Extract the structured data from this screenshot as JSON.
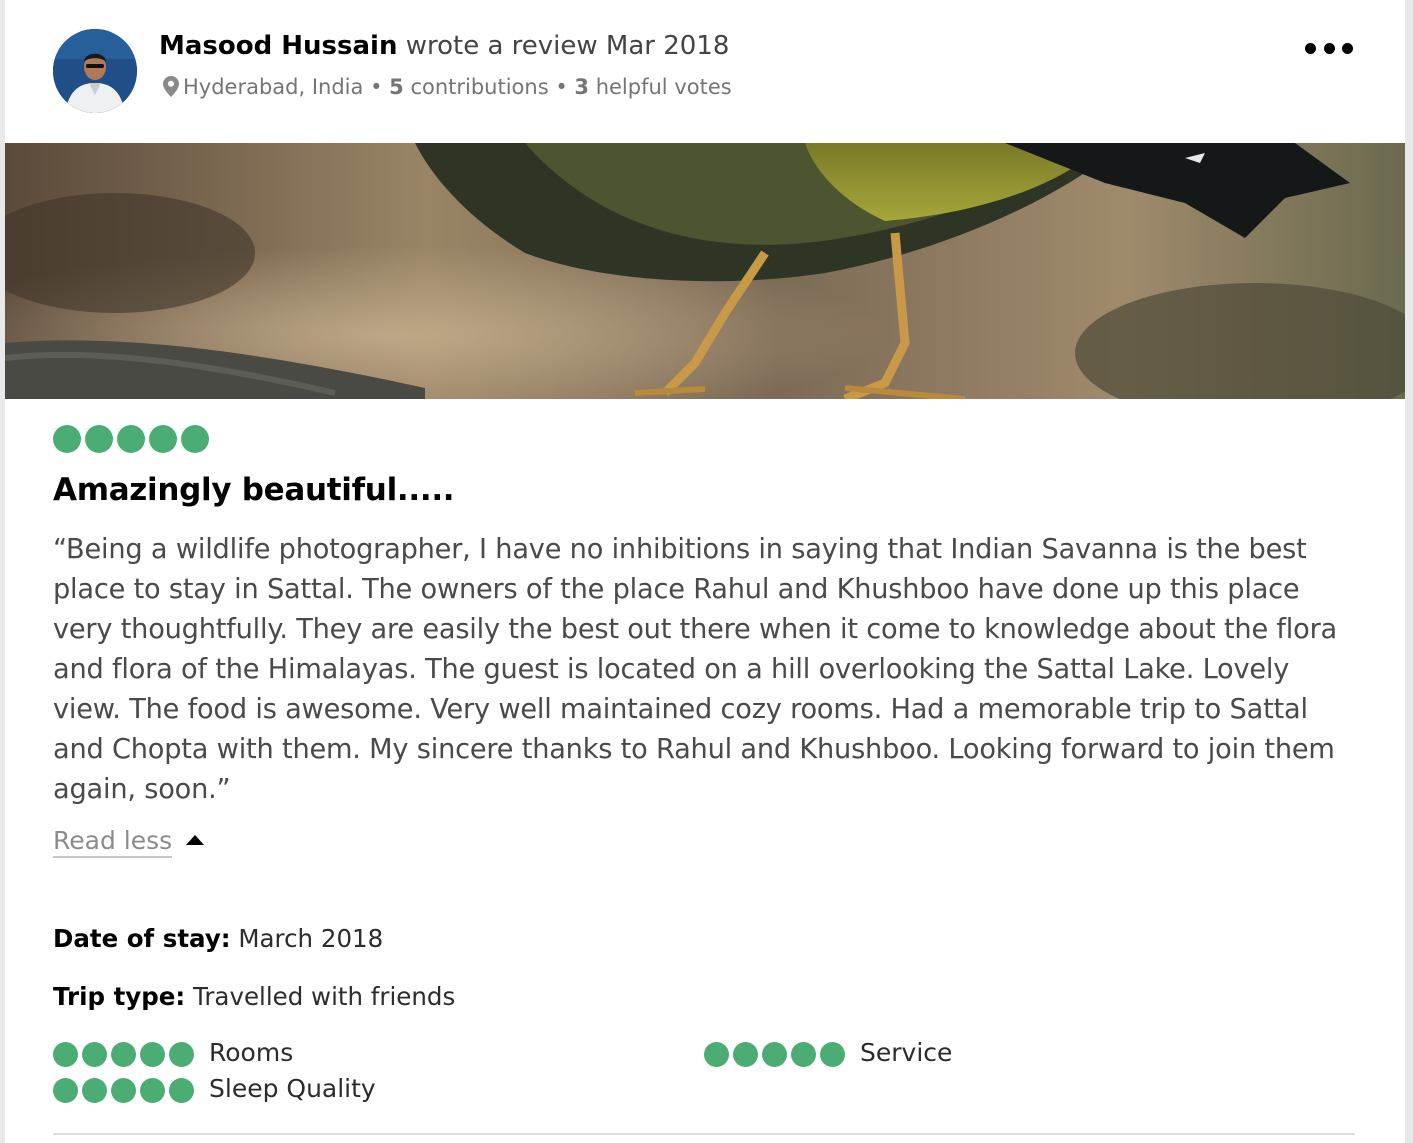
{
  "review": {
    "author_name": "Masood Hussain",
    "wrote_text": " wrote a review Mar 2018",
    "location": "Hyderabad, India",
    "sep1": " • ",
    "contributions_count": "5",
    "contributions_label": " contributions",
    "sep2": " • ",
    "helpful_count": "3",
    "helpful_label": " helpful votes",
    "rating": 5,
    "title": "Amazingly beautiful.....",
    "body": "“Being a wildlife photographer, I have no inhibitions in saying that Indian Savanna is the best place to stay in Sattal. The owners of the place Rahul and Khushboo have done up this place very thoughtfully. They are easily the best out there when it come to knowledge about the flora and flora of the Himalayas. The guest is located on a hill overlooking the Sattal Lake. Lovely view. The food is awesome. Very well maintained cozy rooms. Had a memorable trip to Sattal and Chopta with them. My sincere thanks to Rahul and Khushboo. Looking forward to join them again, soon.”",
    "read_less_label": "Read less",
    "date_of_stay_label": "Date of stay:",
    "date_of_stay_value": " March 2018",
    "trip_type_label": "Trip type:",
    "trip_type_value": " Travelled with friends"
  },
  "sub_ratings": [
    {
      "label": "Rooms",
      "rating": 5
    },
    {
      "label": "Service",
      "rating": 5
    },
    {
      "label": "Sleep Quality",
      "rating": 5
    }
  ],
  "colors": {
    "rating_bubble": "#4bad74",
    "text_primary": "#000000",
    "text_secondary": "#757575"
  },
  "icons": {
    "location": "map-pin-icon",
    "more": "three-dots-icon",
    "read_less": "caret-up-icon"
  }
}
